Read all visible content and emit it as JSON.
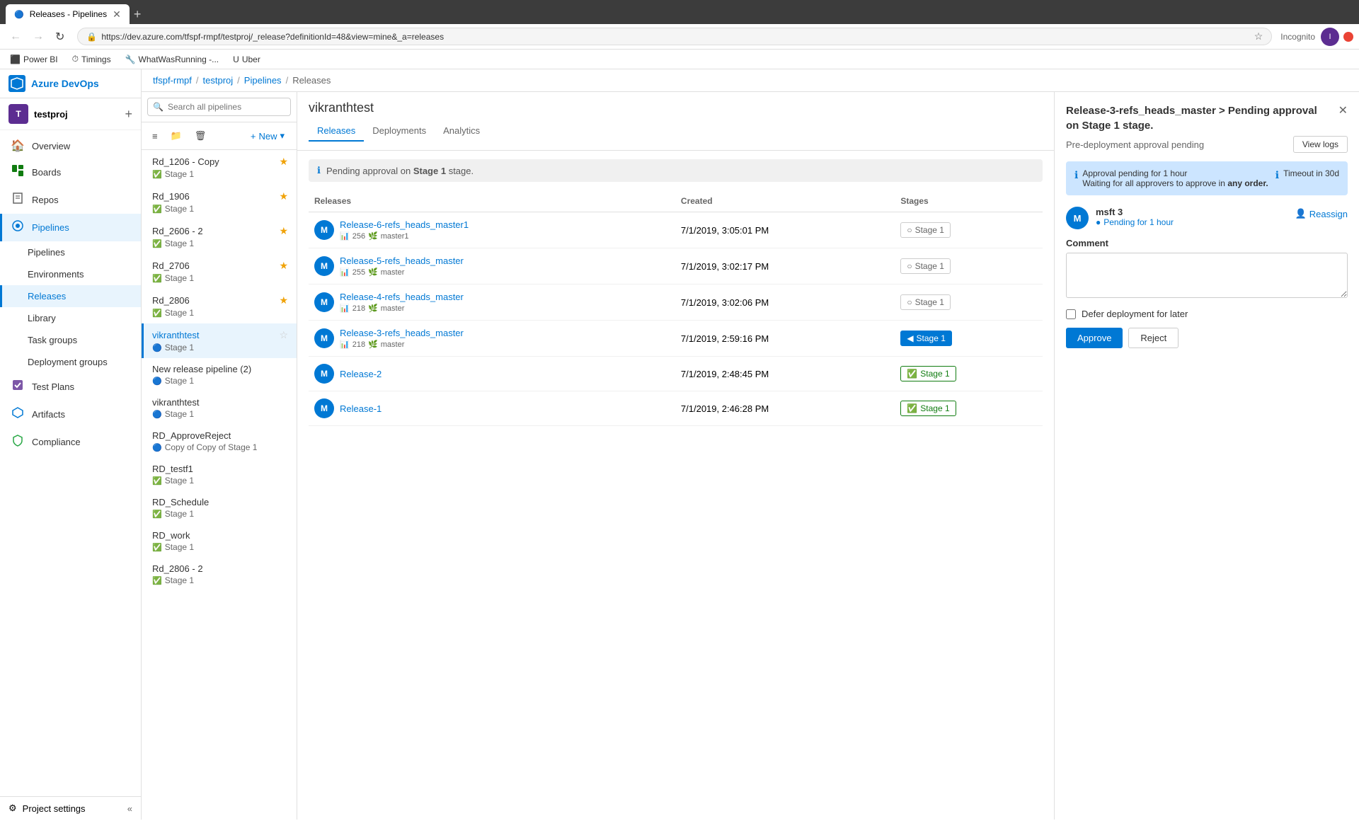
{
  "browser": {
    "tab_title": "Releases - Pipelines",
    "url": "https://dev.azure.com/tfspf-rmpf/testproj/_release?definitionId=48&view=mine&_a=releases",
    "incognito_label": "Incognito",
    "profile_initial": "I"
  },
  "bookmarks": [
    {
      "id": "power-bi",
      "label": "Power BI",
      "icon": "⬛"
    },
    {
      "id": "timings",
      "label": "Timings",
      "icon": "⏱"
    },
    {
      "id": "what-was-running",
      "label": "WhatWasRunning -...",
      "icon": "🔧"
    },
    {
      "id": "uber",
      "label": "Uber",
      "icon": "U"
    }
  ],
  "breadcrumb": {
    "items": [
      "tfspf-rmpf",
      "testproj",
      "Pipelines",
      "Releases"
    ],
    "separator": "/"
  },
  "sidebar": {
    "app_name": "Azure DevOps",
    "project": {
      "name": "testproj",
      "initial": "T"
    },
    "nav_items": [
      {
        "id": "overview",
        "label": "Overview",
        "icon": "🏠"
      },
      {
        "id": "boards",
        "label": "Boards",
        "icon": "📋"
      },
      {
        "id": "repos",
        "label": "Repos",
        "icon": "📁"
      },
      {
        "id": "pipelines",
        "label": "Pipelines",
        "icon": "🔧",
        "active": true
      },
      {
        "id": "pipelines-sub",
        "label": "Pipelines",
        "sub": true
      },
      {
        "id": "environments",
        "label": "Environments",
        "sub": true
      },
      {
        "id": "releases",
        "label": "Releases",
        "sub": true,
        "active_sub": true
      },
      {
        "id": "library",
        "label": "Library",
        "sub": true
      },
      {
        "id": "task-groups",
        "label": "Task groups",
        "sub": true
      },
      {
        "id": "deployment-groups",
        "label": "Deployment groups",
        "sub": true
      },
      {
        "id": "test-plans",
        "label": "Test Plans",
        "icon": "✅"
      },
      {
        "id": "artifacts",
        "label": "Artifacts",
        "icon": "📦"
      },
      {
        "id": "compliance",
        "label": "Compliance",
        "icon": "🛡"
      }
    ],
    "footer": {
      "label": "Project settings",
      "icon": "⚙"
    }
  },
  "pipeline_panel": {
    "search_placeholder": "Search all pipelines",
    "new_label": "New",
    "pipelines": [
      {
        "id": "rd1206",
        "name": "Rd_1206 - Copy",
        "stage": "Stage 1",
        "stage_status": "success",
        "starred": true
      },
      {
        "id": "rd1906",
        "name": "Rd_1906",
        "stage": "Stage 1",
        "stage_status": "success",
        "starred": true
      },
      {
        "id": "rd2606",
        "name": "Rd_2606 - 2",
        "stage": "Stage 1",
        "stage_status": "success",
        "starred": true
      },
      {
        "id": "rd2706",
        "name": "Rd_2706",
        "stage": "Stage 1",
        "stage_status": "success",
        "starred": true
      },
      {
        "id": "rd2806",
        "name": "Rd_2806",
        "stage": "Stage 1",
        "stage_status": "success",
        "starred": true
      },
      {
        "id": "vikranthtest",
        "name": "vikranthtest",
        "stage": "Stage 1",
        "stage_status": "info",
        "starred": false,
        "selected": true
      },
      {
        "id": "new-release-pipeline",
        "name": "New release pipeline (2)",
        "stage": "Stage 1",
        "stage_status": "info",
        "starred": false
      },
      {
        "id": "vikranthtest2",
        "name": "vikranthtest",
        "stage": "Stage 1",
        "stage_status": "info",
        "starred": false
      },
      {
        "id": "rd-approve-reject",
        "name": "RD_ApproveReject",
        "stage": "Copy of Copy of Stage 1",
        "stage_status": "info",
        "starred": false
      },
      {
        "id": "rd-testf1",
        "name": "RD_testf1",
        "stage": "Stage 1",
        "stage_status": "success",
        "starred": false
      },
      {
        "id": "rd-schedule",
        "name": "RD_Schedule",
        "stage": "Stage 1",
        "stage_status": "success",
        "starred": false
      },
      {
        "id": "rd-work",
        "name": "RD_work",
        "stage": "Stage 1",
        "stage_status": "success",
        "starred": false
      },
      {
        "id": "rd2806-2",
        "name": "Rd_2806 - 2",
        "stage": "Stage 1",
        "stage_status": "success",
        "starred": false
      }
    ]
  },
  "release_detail": {
    "title": "vikranthtest",
    "tabs": [
      {
        "id": "releases",
        "label": "Releases",
        "active": true
      },
      {
        "id": "deployments",
        "label": "Deployments",
        "active": false
      },
      {
        "id": "analytics",
        "label": "Analytics",
        "active": false
      }
    ],
    "approval_notice": "Pending approval on Stage 1 stage.",
    "table_headers": [
      "Releases",
      "Created",
      "Stages"
    ],
    "releases": [
      {
        "id": "release-6",
        "name": "Release-6-refs_heads_master1",
        "avatar": "M",
        "build_number": "256",
        "branch": "master1",
        "created": "7/1/2019, 3:05:01 PM",
        "stage": "Stage 1",
        "stage_status": "empty"
      },
      {
        "id": "release-5",
        "name": "Release-5-refs_heads_master",
        "avatar": "M",
        "build_number": "255",
        "branch": "master",
        "created": "7/1/2019, 3:02:17 PM",
        "stage": "Stage 1",
        "stage_status": "empty"
      },
      {
        "id": "release-4",
        "name": "Release-4-refs_heads_master",
        "avatar": "M",
        "build_number": "218",
        "branch": "master",
        "created": "7/1/2019, 3:02:06 PM",
        "stage": "Stage 1",
        "stage_status": "empty"
      },
      {
        "id": "release-3",
        "name": "Release-3-refs_heads_master",
        "avatar": "M",
        "build_number": "218",
        "branch": "master",
        "created": "7/1/2019, 2:59:16 PM",
        "stage": "Stage 1",
        "stage_status": "pending"
      },
      {
        "id": "release-2",
        "name": "Release-2",
        "avatar": "M",
        "build_number": null,
        "branch": null,
        "created": "7/1/2019, 2:48:45 PM",
        "stage": "Stage 1",
        "stage_status": "success"
      },
      {
        "id": "release-1",
        "name": "Release-1",
        "avatar": "M",
        "build_number": null,
        "branch": null,
        "created": "7/1/2019, 2:46:28 PM",
        "stage": "Stage 1",
        "stage_status": "success"
      }
    ]
  },
  "approval_panel": {
    "title": "Release-3-refs_heads_master > Pending approval on Stage 1 stage.",
    "subtitle": "Pre-deployment approval pending",
    "view_logs_label": "View logs",
    "info_box": {
      "left_icon": "ℹ",
      "left_text": "Approval pending for 1 hour",
      "right_icon": "ℹ",
      "right_text": "Timeout in 30d",
      "sub_text": "Waiting for all approvers to approve in any order."
    },
    "approver": {
      "name": "msft 3",
      "avatar": "M",
      "status": "Pending for 1 hour"
    },
    "reassign_label": "Reassign",
    "comment_label": "Comment",
    "comment_placeholder": "",
    "defer_label": "Defer deployment for later",
    "approve_label": "Approve",
    "reject_label": "Reject"
  }
}
